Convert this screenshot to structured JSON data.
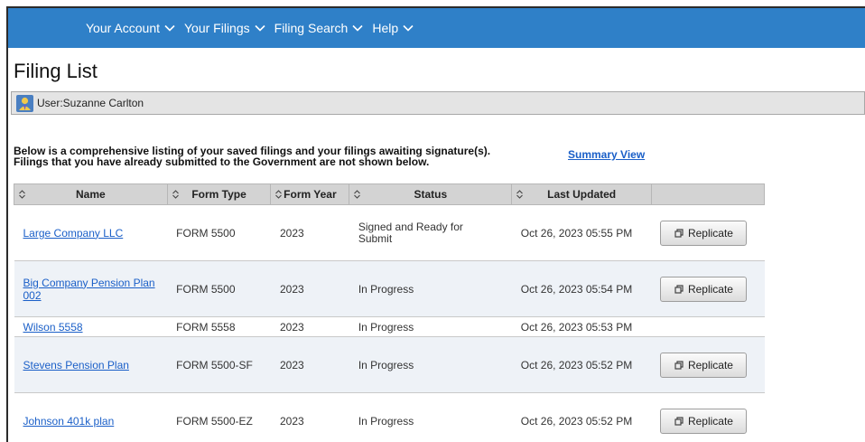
{
  "nav": {
    "items": [
      {
        "label": "Your Account"
      },
      {
        "label": "Your Filings"
      },
      {
        "label": "Filing Search"
      },
      {
        "label": "Help"
      }
    ]
  },
  "page": {
    "title": "Filing List",
    "user_label": "User:Suzanne Carlton",
    "intro_line1": "Below is a comprehensive listing of your saved filings and your filings awaiting signature(s).",
    "intro_line2": "Filings that you have already submitted to the Government are not shown below.",
    "summary_link": "Summary View"
  },
  "table": {
    "headers": [
      "Name",
      "Form Type",
      "Form Year",
      "Status",
      "Last Updated"
    ],
    "replicate_label": "Replicate",
    "rows": [
      {
        "name": "Large Company LLC",
        "form_type": "FORM 5500",
        "form_year": "2023",
        "status": "Signed and Ready for Submit",
        "last_updated": "Oct 26, 2023 05:55 PM"
      },
      {
        "name": "Big Company Pension Plan 002",
        "form_type": "FORM 5500",
        "form_year": "2023",
        "status": "In Progress",
        "last_updated": "Oct 26, 2023 05:54 PM"
      },
      {
        "name": "Wilson 5558",
        "form_type": "FORM 5558",
        "form_year": "2023",
        "status": "In Progress",
        "last_updated": "Oct 26, 2023 05:53 PM"
      },
      {
        "name": "Stevens Pension Plan",
        "form_type": "FORM 5500-SF",
        "form_year": "2023",
        "status": "In Progress",
        "last_updated": "Oct 26, 2023 05:52 PM"
      },
      {
        "name": "Johnson 401k plan",
        "form_type": "FORM 5500-EZ",
        "form_year": "2023",
        "status": "In Progress",
        "last_updated": "Oct 26, 2023 05:52 PM"
      }
    ]
  },
  "colors": {
    "nav_bg": "#2f80c8",
    "link": "#1a5fc8",
    "header_bg": "#d3d3d3",
    "alt_row": "#eef2f7"
  }
}
